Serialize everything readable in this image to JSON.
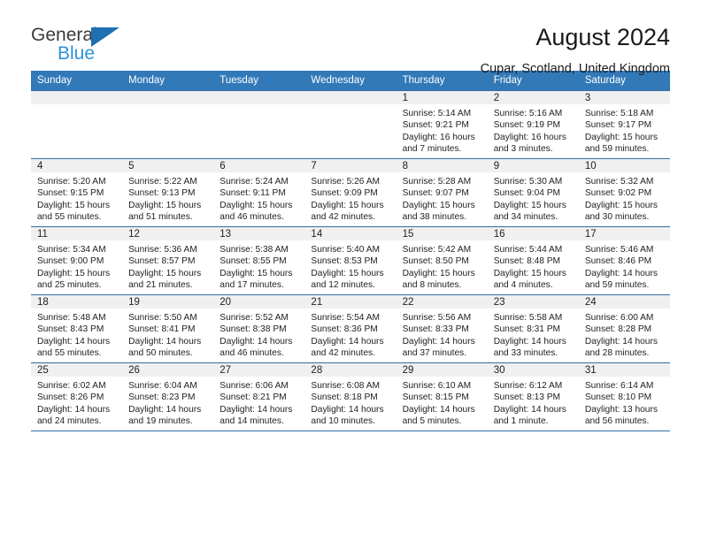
{
  "brand": {
    "line1": "General",
    "line2": "Blue",
    "triangle_color": "#1f6fb2",
    "blue_text_color": "#2e90d9"
  },
  "header": {
    "title": "August 2024",
    "subtitle": "Cupar, Scotland, United Kingdom"
  },
  "theme": {
    "header_row_bg": "#3279b8",
    "header_row_text": "#ffffff",
    "daynum_bg": "#f0f0f0",
    "grid_line": "#2f6fa8"
  },
  "weekdays": [
    "Sunday",
    "Monday",
    "Tuesday",
    "Wednesday",
    "Thursday",
    "Friday",
    "Saturday"
  ],
  "weeks": [
    [
      {
        "day": "",
        "sunrise": "",
        "sunset": "",
        "daylight1": "",
        "daylight2": "",
        "empty": true
      },
      {
        "day": "",
        "sunrise": "",
        "sunset": "",
        "daylight1": "",
        "daylight2": "",
        "empty": true
      },
      {
        "day": "",
        "sunrise": "",
        "sunset": "",
        "daylight1": "",
        "daylight2": "",
        "empty": true
      },
      {
        "day": "",
        "sunrise": "",
        "sunset": "",
        "daylight1": "",
        "daylight2": "",
        "empty": true
      },
      {
        "day": "1",
        "sunrise": "Sunrise: 5:14 AM",
        "sunset": "Sunset: 9:21 PM",
        "daylight1": "Daylight: 16 hours",
        "daylight2": "and 7 minutes."
      },
      {
        "day": "2",
        "sunrise": "Sunrise: 5:16 AM",
        "sunset": "Sunset: 9:19 PM",
        "daylight1": "Daylight: 16 hours",
        "daylight2": "and 3 minutes."
      },
      {
        "day": "3",
        "sunrise": "Sunrise: 5:18 AM",
        "sunset": "Sunset: 9:17 PM",
        "daylight1": "Daylight: 15 hours",
        "daylight2": "and 59 minutes."
      }
    ],
    [
      {
        "day": "4",
        "sunrise": "Sunrise: 5:20 AM",
        "sunset": "Sunset: 9:15 PM",
        "daylight1": "Daylight: 15 hours",
        "daylight2": "and 55 minutes."
      },
      {
        "day": "5",
        "sunrise": "Sunrise: 5:22 AM",
        "sunset": "Sunset: 9:13 PM",
        "daylight1": "Daylight: 15 hours",
        "daylight2": "and 51 minutes."
      },
      {
        "day": "6",
        "sunrise": "Sunrise: 5:24 AM",
        "sunset": "Sunset: 9:11 PM",
        "daylight1": "Daylight: 15 hours",
        "daylight2": "and 46 minutes."
      },
      {
        "day": "7",
        "sunrise": "Sunrise: 5:26 AM",
        "sunset": "Sunset: 9:09 PM",
        "daylight1": "Daylight: 15 hours",
        "daylight2": "and 42 minutes."
      },
      {
        "day": "8",
        "sunrise": "Sunrise: 5:28 AM",
        "sunset": "Sunset: 9:07 PM",
        "daylight1": "Daylight: 15 hours",
        "daylight2": "and 38 minutes."
      },
      {
        "day": "9",
        "sunrise": "Sunrise: 5:30 AM",
        "sunset": "Sunset: 9:04 PM",
        "daylight1": "Daylight: 15 hours",
        "daylight2": "and 34 minutes."
      },
      {
        "day": "10",
        "sunrise": "Sunrise: 5:32 AM",
        "sunset": "Sunset: 9:02 PM",
        "daylight1": "Daylight: 15 hours",
        "daylight2": "and 30 minutes."
      }
    ],
    [
      {
        "day": "11",
        "sunrise": "Sunrise: 5:34 AM",
        "sunset": "Sunset: 9:00 PM",
        "daylight1": "Daylight: 15 hours",
        "daylight2": "and 25 minutes."
      },
      {
        "day": "12",
        "sunrise": "Sunrise: 5:36 AM",
        "sunset": "Sunset: 8:57 PM",
        "daylight1": "Daylight: 15 hours",
        "daylight2": "and 21 minutes."
      },
      {
        "day": "13",
        "sunrise": "Sunrise: 5:38 AM",
        "sunset": "Sunset: 8:55 PM",
        "daylight1": "Daylight: 15 hours",
        "daylight2": "and 17 minutes."
      },
      {
        "day": "14",
        "sunrise": "Sunrise: 5:40 AM",
        "sunset": "Sunset: 8:53 PM",
        "daylight1": "Daylight: 15 hours",
        "daylight2": "and 12 minutes."
      },
      {
        "day": "15",
        "sunrise": "Sunrise: 5:42 AM",
        "sunset": "Sunset: 8:50 PM",
        "daylight1": "Daylight: 15 hours",
        "daylight2": "and 8 minutes."
      },
      {
        "day": "16",
        "sunrise": "Sunrise: 5:44 AM",
        "sunset": "Sunset: 8:48 PM",
        "daylight1": "Daylight: 15 hours",
        "daylight2": "and 4 minutes."
      },
      {
        "day": "17",
        "sunrise": "Sunrise: 5:46 AM",
        "sunset": "Sunset: 8:46 PM",
        "daylight1": "Daylight: 14 hours",
        "daylight2": "and 59 minutes."
      }
    ],
    [
      {
        "day": "18",
        "sunrise": "Sunrise: 5:48 AM",
        "sunset": "Sunset: 8:43 PM",
        "daylight1": "Daylight: 14 hours",
        "daylight2": "and 55 minutes."
      },
      {
        "day": "19",
        "sunrise": "Sunrise: 5:50 AM",
        "sunset": "Sunset: 8:41 PM",
        "daylight1": "Daylight: 14 hours",
        "daylight2": "and 50 minutes."
      },
      {
        "day": "20",
        "sunrise": "Sunrise: 5:52 AM",
        "sunset": "Sunset: 8:38 PM",
        "daylight1": "Daylight: 14 hours",
        "daylight2": "and 46 minutes."
      },
      {
        "day": "21",
        "sunrise": "Sunrise: 5:54 AM",
        "sunset": "Sunset: 8:36 PM",
        "daylight1": "Daylight: 14 hours",
        "daylight2": "and 42 minutes."
      },
      {
        "day": "22",
        "sunrise": "Sunrise: 5:56 AM",
        "sunset": "Sunset: 8:33 PM",
        "daylight1": "Daylight: 14 hours",
        "daylight2": "and 37 minutes."
      },
      {
        "day": "23",
        "sunrise": "Sunrise: 5:58 AM",
        "sunset": "Sunset: 8:31 PM",
        "daylight1": "Daylight: 14 hours",
        "daylight2": "and 33 minutes."
      },
      {
        "day": "24",
        "sunrise": "Sunrise: 6:00 AM",
        "sunset": "Sunset: 8:28 PM",
        "daylight1": "Daylight: 14 hours",
        "daylight2": "and 28 minutes."
      }
    ],
    [
      {
        "day": "25",
        "sunrise": "Sunrise: 6:02 AM",
        "sunset": "Sunset: 8:26 PM",
        "daylight1": "Daylight: 14 hours",
        "daylight2": "and 24 minutes."
      },
      {
        "day": "26",
        "sunrise": "Sunrise: 6:04 AM",
        "sunset": "Sunset: 8:23 PM",
        "daylight1": "Daylight: 14 hours",
        "daylight2": "and 19 minutes."
      },
      {
        "day": "27",
        "sunrise": "Sunrise: 6:06 AM",
        "sunset": "Sunset: 8:21 PM",
        "daylight1": "Daylight: 14 hours",
        "daylight2": "and 14 minutes."
      },
      {
        "day": "28",
        "sunrise": "Sunrise: 6:08 AM",
        "sunset": "Sunset: 8:18 PM",
        "daylight1": "Daylight: 14 hours",
        "daylight2": "and 10 minutes."
      },
      {
        "day": "29",
        "sunrise": "Sunrise: 6:10 AM",
        "sunset": "Sunset: 8:15 PM",
        "daylight1": "Daylight: 14 hours",
        "daylight2": "and 5 minutes."
      },
      {
        "day": "30",
        "sunrise": "Sunrise: 6:12 AM",
        "sunset": "Sunset: 8:13 PM",
        "daylight1": "Daylight: 14 hours",
        "daylight2": "and 1 minute."
      },
      {
        "day": "31",
        "sunrise": "Sunrise: 6:14 AM",
        "sunset": "Sunset: 8:10 PM",
        "daylight1": "Daylight: 13 hours",
        "daylight2": "and 56 minutes."
      }
    ]
  ]
}
